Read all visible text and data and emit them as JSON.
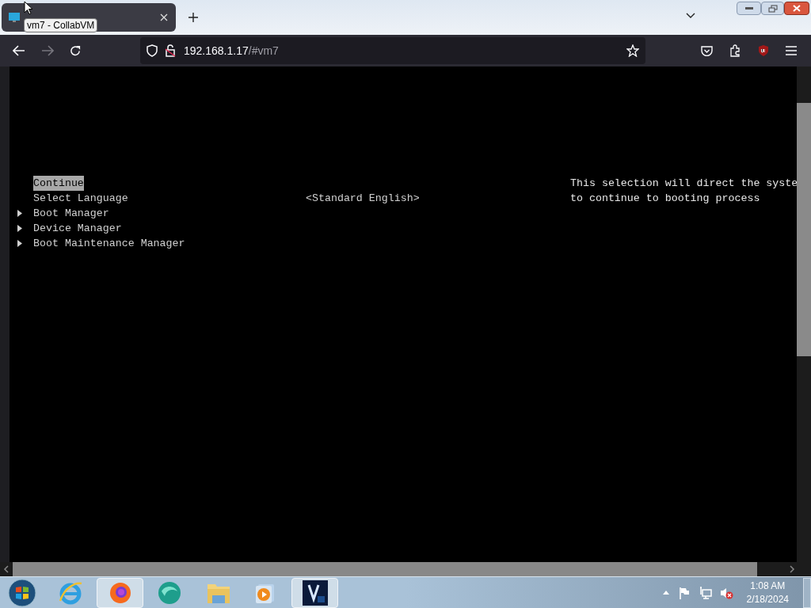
{
  "tooltip": "vm7 - CollabVM",
  "address_bar": {
    "host": "192.168.1.17",
    "path": "/#vm7"
  },
  "menu": [
    {
      "label": "Continue",
      "kind": "action",
      "selected": true
    },
    {
      "label": "Select Language",
      "kind": "option",
      "value": "<Standard English>",
      "selected": false
    },
    {
      "label": "Boot Manager",
      "kind": "submenu",
      "selected": false
    },
    {
      "label": "Device Manager",
      "kind": "submenu",
      "selected": false
    },
    {
      "label": "Boot Maintenance Manager",
      "kind": "submenu",
      "selected": false
    }
  ],
  "help_text": [
    "This selection will direct the syste",
    "to continue to booting process"
  ],
  "clock": {
    "time": "1:08 AM",
    "date": "2/18/2024"
  }
}
